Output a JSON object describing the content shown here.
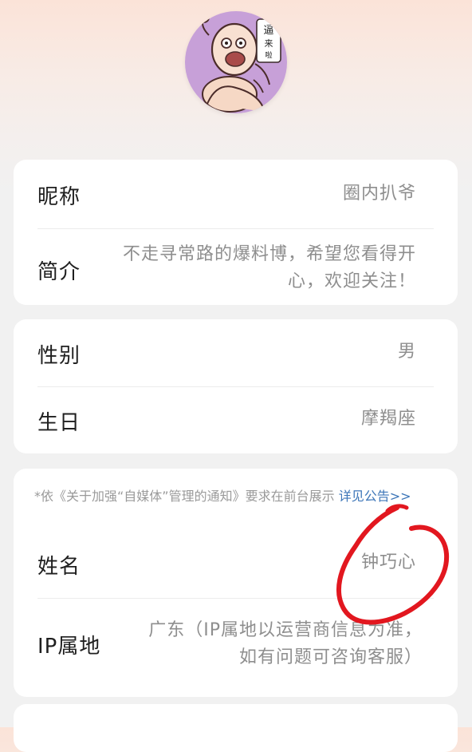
{
  "profile": {
    "avatar_icon": "cartoon-avatar-icon",
    "avatar_text_line1": "逼",
    "avatar_text_line2": "来",
    "avatar_text_line3": "啦"
  },
  "basic_info": {
    "nickname_label": "昵称",
    "nickname_value": "圈内扒爷",
    "intro_label": "简介",
    "intro_line1": "不走寻常路的爆料博，希望您看得开",
    "intro_line2": "心，欢迎关注！"
  },
  "personal_info": {
    "gender_label": "性别",
    "gender_value": "男",
    "birthday_label": "生日",
    "birthday_value": "摩羯座"
  },
  "verification": {
    "notice_text": "*依《关于加强“自媒体”管理的通知》要求在前台展示",
    "notice_link_text": "详见公告>>",
    "name_label": "姓名",
    "name_value": "钟巧心",
    "ip_label": "IP属地",
    "ip_line1": "广东（IP属地以运营商信息为准，",
    "ip_line2": "如有问题可咨询客服）"
  },
  "colors": {
    "accent_link": "#3d76b8",
    "circle_annotation": "#e2171f"
  }
}
